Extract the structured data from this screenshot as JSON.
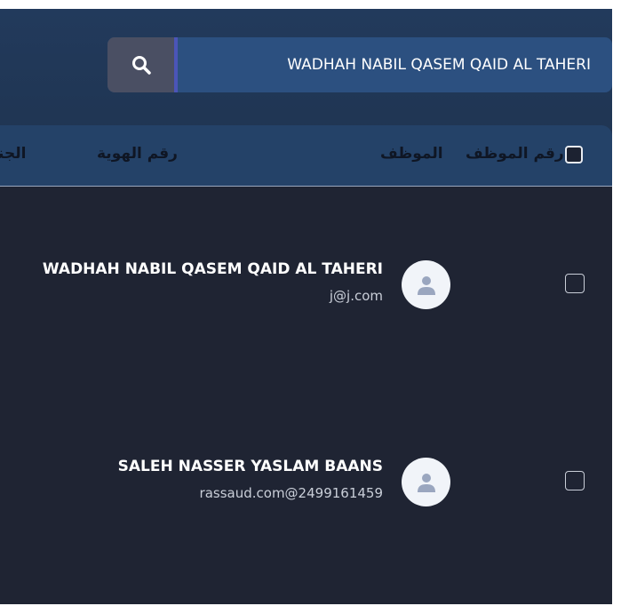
{
  "search": {
    "value": "WADHAH NABIL QASEM QAID AL TAHERI",
    "button_icon": "search-icon"
  },
  "table": {
    "headers": {
      "employee_number": "رقم الموظف",
      "employee": "الموظف",
      "id_number": "رقم الهوية",
      "gender": "الجنس"
    },
    "rows": [
      {
        "name": "WADHAH NABIL QASEM QAID AL TAHERI",
        "email": "j@j.com",
        "avatar_icon": "user-icon"
      },
      {
        "name": "SALEH NASSER YASLAM BAANS",
        "email": "rassaud.com@2499161459",
        "avatar_icon": "user-icon"
      }
    ]
  },
  "colors": {
    "panel_bg": "#1f2433",
    "header_band": "#223a5c",
    "search_field": "#2c5080",
    "search_button": "#4a4f63",
    "accent": "#4b55b8"
  }
}
